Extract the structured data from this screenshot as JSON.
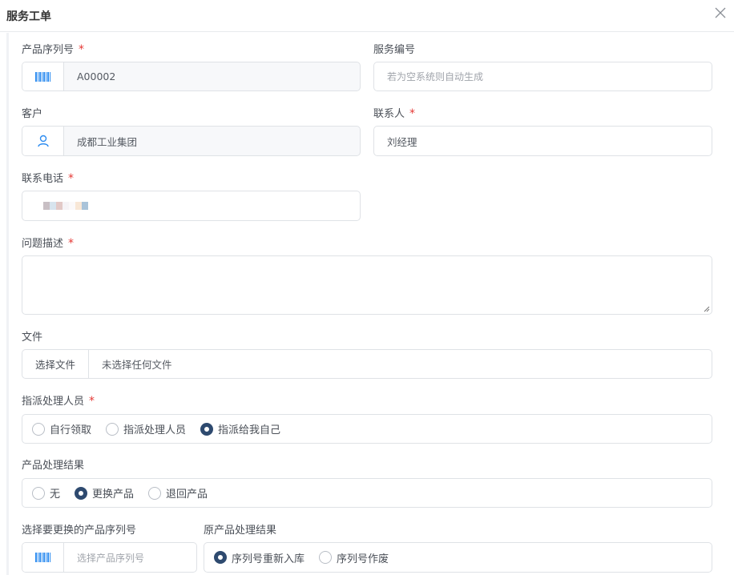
{
  "dialog": {
    "title": "服务工单",
    "close_icon": "close-icon"
  },
  "form": {
    "serial": {
      "label": "产品序列号",
      "required": "*",
      "value": "A00002",
      "icon": "barcode-icon"
    },
    "service_no": {
      "label": "服务编号",
      "placeholder": "若为空系统则自动生成"
    },
    "customer": {
      "label": "客户",
      "value": "成都工业集团",
      "icon": "user-icon"
    },
    "contact": {
      "label": "联系人",
      "required": "*",
      "value": "刘经理"
    },
    "phone": {
      "label": "联系电话",
      "required": "*"
    },
    "description": {
      "label": "问题描述",
      "required": "*",
      "value": ""
    },
    "file": {
      "label": "文件",
      "button": "选择文件",
      "status": "未选择任何文件"
    },
    "assign": {
      "label": "指派处理人员",
      "required": "*",
      "options": [
        "自行领取",
        "指派处理人员",
        "指派给我自己"
      ],
      "selected": 2
    },
    "result": {
      "label": "产品处理结果",
      "options": [
        "无",
        "更换产品",
        "退回产品"
      ],
      "selected": 1
    },
    "replace_serial": {
      "label": "选择要更换的产品序列号",
      "placeholder": "选择产品序列号",
      "icon": "barcode-icon"
    },
    "original_result": {
      "label": "原产品处理结果",
      "options": [
        "序列号重新入库",
        "序列号作废"
      ],
      "selected": 0
    }
  },
  "colors": {
    "accent": "#2e4a6f",
    "required": "#e53935",
    "icon_blue": "#2d8cf0"
  }
}
